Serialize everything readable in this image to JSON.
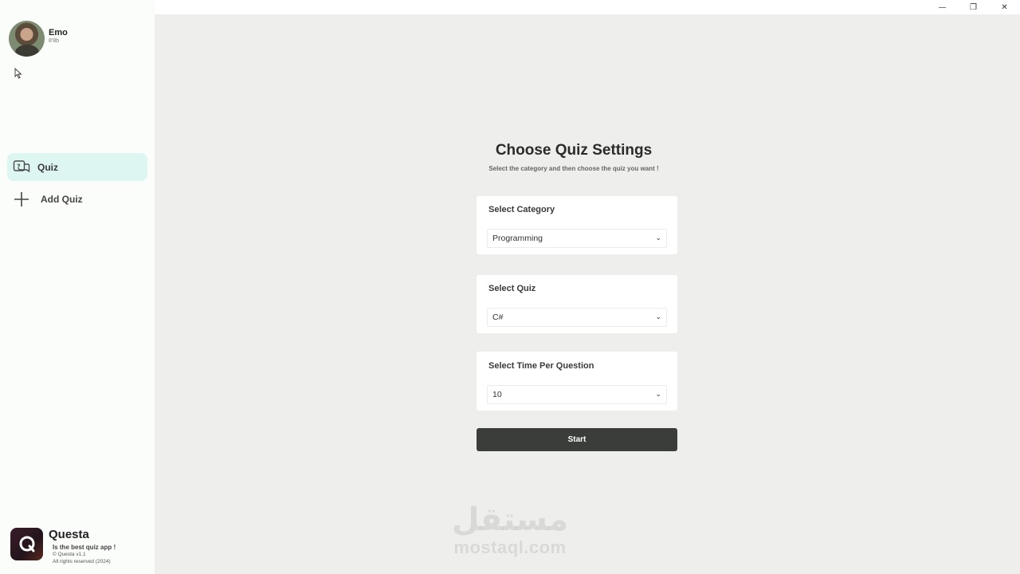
{
  "window": {
    "controls": {
      "minimize": "—",
      "restore": "❐",
      "close": "✕"
    }
  },
  "profile": {
    "name": "Emo",
    "subtitle": "8'8b"
  },
  "sidebar": {
    "items": [
      {
        "label": "Quiz",
        "icon": "quiz-chat-icon",
        "active": true
      },
      {
        "label": "Add Quiz",
        "icon": "plus-icon",
        "active": false
      }
    ]
  },
  "brand": {
    "name": "Questa",
    "tagline": "Is the best quiz app !",
    "version": "© Questa v1.1",
    "rights": "All rights reserved (2024)"
  },
  "main": {
    "title": "Choose Quiz Settings",
    "subtitle": "Select the category and then choose the quiz you want !",
    "fields": [
      {
        "label": "Select Category",
        "value": "Programming"
      },
      {
        "label": "Select Quiz",
        "value": "C#"
      },
      {
        "label": "Select Time Per Question",
        "value": "10"
      }
    ],
    "start_label": "Start"
  },
  "watermark": {
    "arabic": "مستقل",
    "latin": "mostaql.com"
  },
  "colors": {
    "background": "#eeefec",
    "sidebar": "#fbfdfb",
    "active_nav": "#ddf6f2",
    "start_button": "#3a3d39"
  }
}
